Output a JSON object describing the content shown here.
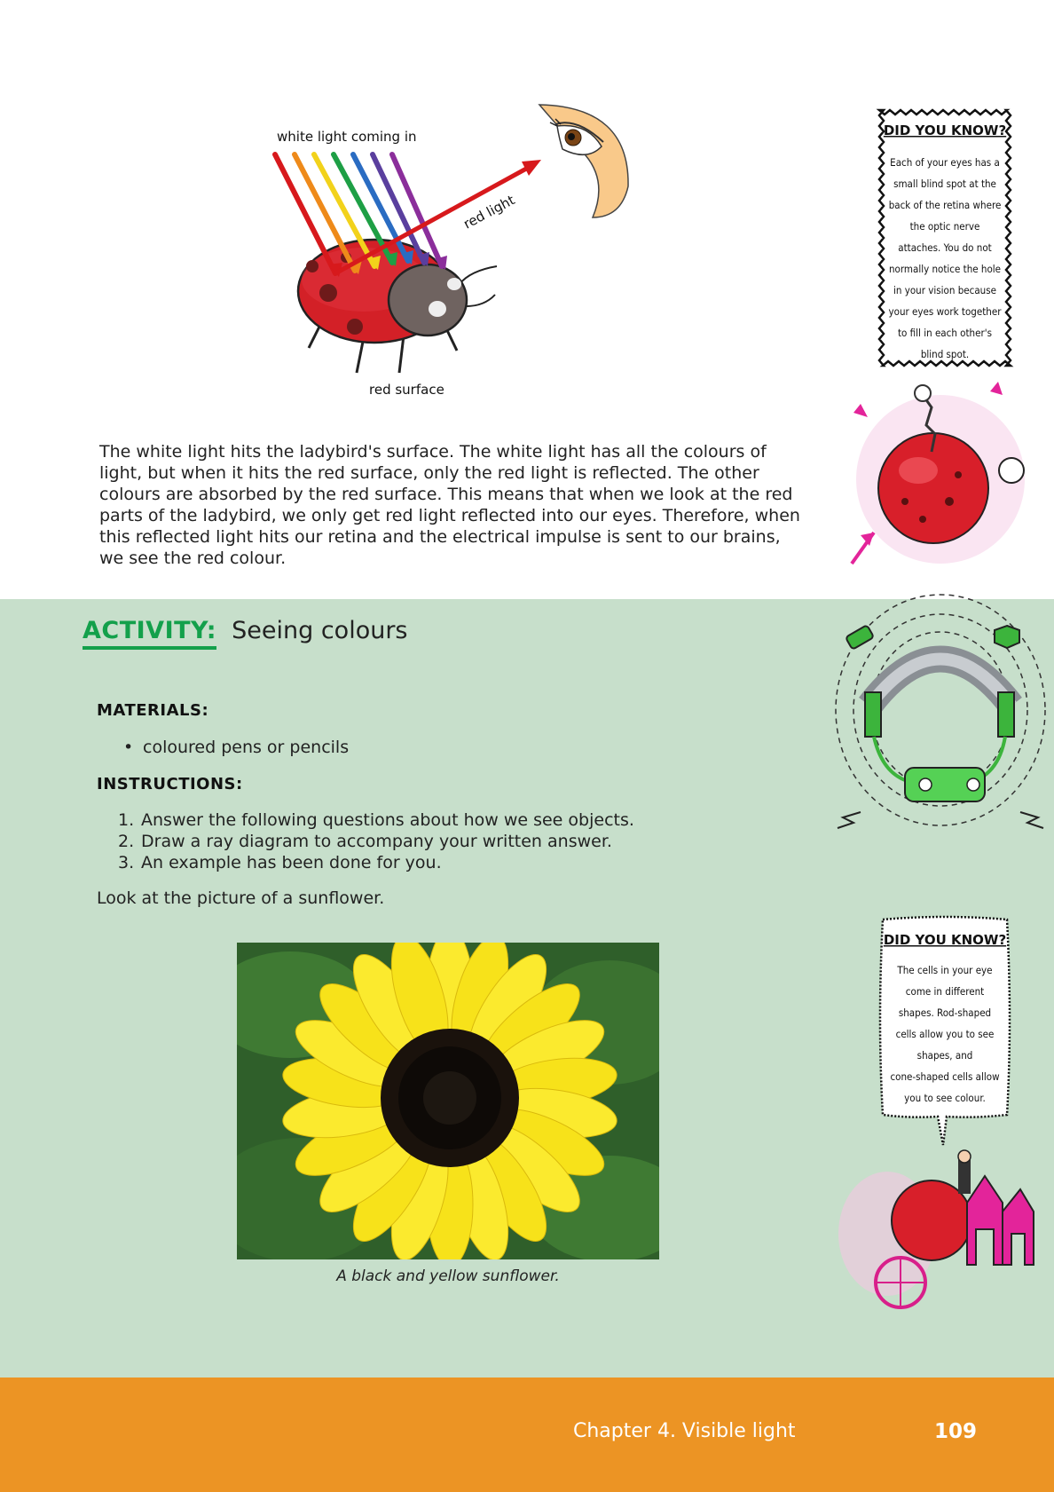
{
  "diagram": {
    "incoming_label": "white light coming in",
    "reflected_label": "red light",
    "surface_label": "red surface"
  },
  "intro": {
    "text": "The white light hits the ladybird's surface. The white light has all the colours of light, but when it hits the red surface, only the red light is reflected. The other colours are absorbed by the red surface. This means that when we look at the red parts of the ladybird, we only get red light reflected into our eyes. Therefore, when this reflected light hits our retina and the electrical impulse is sent to our brains, we see the red colour."
  },
  "activity": {
    "label": "ACTIVITY:",
    "title": "Seeing colours",
    "materials_label": "MATERIALS:",
    "materials": [
      "coloured pens or pencils"
    ],
    "instructions_label": "INSTRUCTIONS:",
    "instructions": [
      {
        "num": "1.",
        "text": "Answer the following questions about how we see objects."
      },
      {
        "num": "2.",
        "text": "Draw a ray diagram to accompany your written answer."
      },
      {
        "num": "3.",
        "text": "An example has been done for you."
      }
    ],
    "prompt": "Look at the picture of a sunflower.",
    "photo_caption": "A black and yellow sunflower."
  },
  "sidebar": {
    "did_you_know_1": {
      "title": "DID YOU KNOW?",
      "lines": [
        "Each of your eyes has a",
        "small blind spot at the",
        "back of the retina where",
        "the optic nerve",
        "attaches. You do not",
        "normally notice the hole",
        "in your vision because",
        "your eyes work together",
        "to fill in each other's",
        "blind spot."
      ]
    },
    "did_you_know_2": {
      "title": "DID YOU KNOW?",
      "lines": [
        "The cells in your eye",
        "come in different",
        "shapes. Rod-shaped",
        "cells allow you to see",
        "shapes, and",
        "cone-shaped cells allow",
        "you to see colour."
      ]
    }
  },
  "footer": {
    "chapter": "Chapter 4.   Visible light",
    "page_number": "109"
  },
  "colors": {
    "activity_green": "#13a04b",
    "activity_background": "#c7dfcb",
    "footer_orange": "#ec9424"
  }
}
